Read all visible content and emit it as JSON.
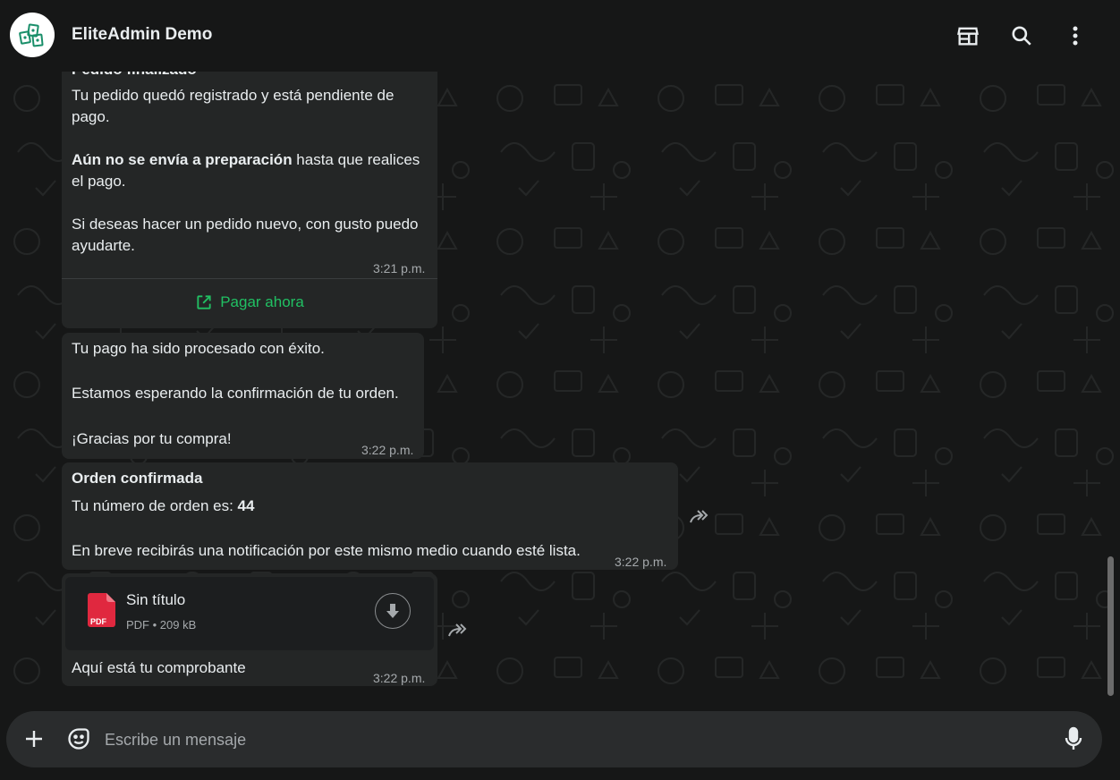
{
  "header": {
    "title": "EliteAdmin Demo",
    "icons": [
      "store-icon",
      "search-icon",
      "more-vertical-icon"
    ]
  },
  "messages": [
    {
      "heading": "Pedido finalizado",
      "lines": [
        "Tu pedido quedó registrado y está pendiente de",
        "pago."
      ],
      "bold_line": "Aún no se envía a preparación",
      "bold_rest": " hasta que realices",
      "line3": "el pago.",
      "line4": "Si deseas hacer un pedido nuevo, con gusto puedo",
      "line5": "ayudarte.",
      "time": "3:21 p.m.",
      "button": "Pagar ahora"
    },
    {
      "line1": "Tu pago ha sido procesado con éxito.",
      "line2": "Estamos esperando la confirmación de tu orden.",
      "line3": "¡Gracias por tu compra!",
      "time": "3:22 p.m."
    },
    {
      "heading": "Orden confirmada",
      "line1_prefix": "Tu número de orden es: ",
      "order_number": "44",
      "line2": "En breve recibirás una notificación por este mismo medio cuando esté lista.",
      "time": "3:22 p.m."
    },
    {
      "file_name": "Sin título",
      "file_type": "PDF",
      "file_size": "209 kB",
      "icon_label": "PDF",
      "caption": "Aquí está tu comprobante",
      "time": "3:22 p.m."
    }
  ],
  "composer": {
    "placeholder": "Escribe un mensaje"
  },
  "colors": {
    "background": "#161717",
    "bubble": "#242626",
    "accent": "#21c063",
    "pdf": "#e0283f"
  }
}
